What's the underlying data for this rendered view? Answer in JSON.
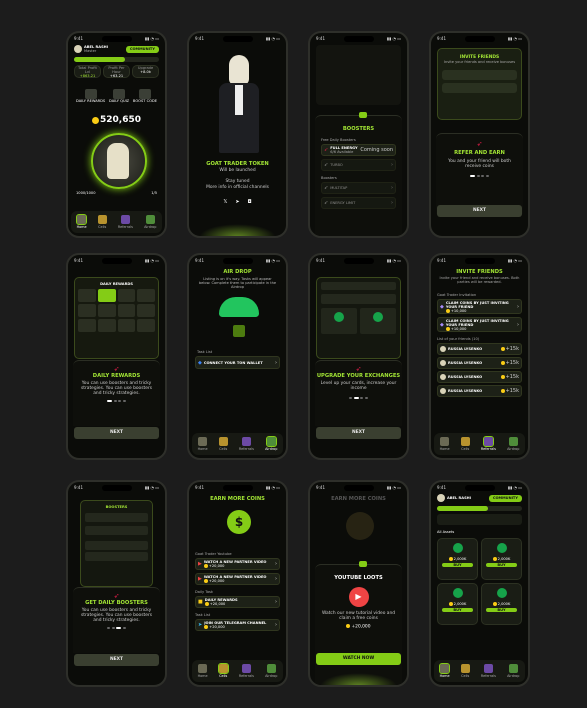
{
  "status": {
    "time": "9:41"
  },
  "nav": {
    "home": "Home",
    "cells": "Cells",
    "referrals": "Referrals",
    "airdrop": "Airdrop"
  },
  "colors": {
    "accent": "#84cc16",
    "bg": "#0b0c09",
    "coin": "#facc15"
  },
  "s1": {
    "user": "ABEL RASHI",
    "rank": "Master",
    "community": "COMMUNITY",
    "stat1_label": "Total Profit Lvl",
    "stat1": "+863.21",
    "stat2_label": "Profit Per Hour",
    "stat2": "+63.21",
    "stat3_label": "Upgrade",
    "stat3": "+8.0k",
    "quest1": "DAILY REWARDS",
    "quest2": "DAILY QUIZ",
    "quest3": "BOOST CODE",
    "balance": "520,650",
    "energy": "1000/1000",
    "level": "1/5",
    "tab_active": "home"
  },
  "s2": {
    "title": "GOAT TRADER TOKEN",
    "subtitle": "Will be launched",
    "stay": "Stay tuned",
    "more": "More info in official channels"
  },
  "s3": {
    "title": "BOOSTERS",
    "free": "Free Daily Boosters",
    "full": "FULL ENERGY",
    "full_sub": "6/6 Available",
    "soon": "Coming soon",
    "turbo": "TURBO",
    "boosters": "Boosters",
    "multitap": "MULTITAP",
    "energy_limit": "ENERGY LIMIT"
  },
  "s4": {
    "title": "INVITE FRIENDS",
    "sub": "Invite your friends and receive bonuses",
    "refer": "REFER AND EARN",
    "desc": "You and your friend will both receive coins",
    "next": "NEXT"
  },
  "s5": {
    "title": "DAILY REWARDS",
    "heading": "DAILY REWARDS",
    "desc": "You can use boosters and tricky strategies. You can use boosters and tricky strategies.",
    "next": "NEXT"
  },
  "s6": {
    "title": "AIR DROP",
    "desc": "Listing is on it's way. Tasks will appear below. Complete them to participate in the Airdrop",
    "tasks": "Task List",
    "connect": "CONNECT YOUR TON WALLET"
  },
  "s7": {
    "heading": "UPGRADE YOUR EXCHANGES",
    "desc": "Level up your cards, increase your income",
    "next": "NEXT"
  },
  "s8": {
    "title": "INVITE FRIENDS",
    "sub": "Invite your friend and receive bonuses. Both parties will be rewarded.",
    "invite_head": "Goat Trader Invitation",
    "invite1": "CLAIM COINS BY JUST INVITING YOUR FRIEND",
    "invite2": "CLAIM COINS BY JUST INVITING YOUR FRIEND",
    "reward": "+10,000",
    "list_head": "List of your friends (10)",
    "friends": [
      {
        "name": "RUSSIA LYSENKO",
        "bonus": "+15k"
      },
      {
        "name": "RUSSIA LYSENKO",
        "bonus": "+15k"
      },
      {
        "name": "RUSSIA LYSENKO",
        "bonus": "+15k"
      },
      {
        "name": "RUSSIA LYSENKO",
        "bonus": "+15k"
      }
    ]
  },
  "s9": {
    "title": "BOOSTERS",
    "heading": "GET DAILY BOOSTERS",
    "desc": "You can use boosters and tricky strategies. You can use boosters and tricky strategies.",
    "next": "NEXT"
  },
  "s10": {
    "title": "EARN MORE COINS",
    "group1": "Goat Trader Youtube",
    "t1": "WATCH A NEW PARTNER VIDEO",
    "t2": "WATCH A NEW PARTNER VIDEO",
    "reward": "+20,000",
    "group2": "Daily Task",
    "t3": "DAILY REWARDS",
    "group3": "Task List",
    "t4": "JOIN OUR TELEGRAM CHANNEL"
  },
  "s11": {
    "title": "EARN MORE COINS",
    "heading": "YOUTUBE LOOTS",
    "desc": "Watch our new tutorial video and claim a free coins",
    "reward": "+20,000",
    "watch": "WATCH NOW"
  },
  "s12": {
    "user": "ABEL RASHI",
    "community": "COMMUNITY",
    "all": "All Assets",
    "card_price": "2,000K",
    "card_buy": "BUY",
    "card_bonus": "+1.0K"
  }
}
